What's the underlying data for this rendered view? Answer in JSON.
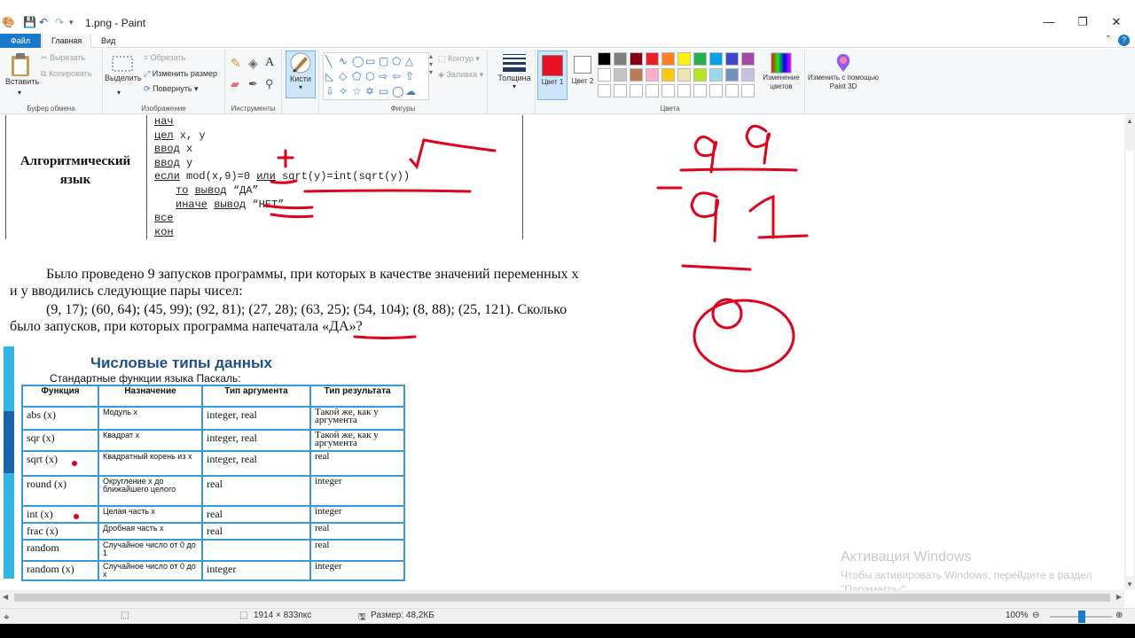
{
  "window": {
    "title": "1.png - Paint",
    "controls": {
      "minimize": "—",
      "maximize": "❐",
      "close": "✕"
    }
  },
  "tabs": {
    "file": "Файл",
    "home": "Главная",
    "view": "Вид"
  },
  "ribbon": {
    "clipboard": {
      "paste": "Вставить",
      "cut": "Вырезать",
      "copy": "Копировать",
      "group": "Буфер обмена"
    },
    "image": {
      "select": "Выделить",
      "crop": "Обрезать",
      "resize": "Изменить размер",
      "rotate": "Повернуть",
      "group": "Изображение"
    },
    "tools": {
      "group": "Инструменты"
    },
    "brushes": {
      "label": "Кисти"
    },
    "shapes": {
      "outline": "Контур",
      "fill": "Заливка",
      "group": "Фигуры"
    },
    "size": {
      "label": "Толщина"
    },
    "colors": {
      "color1": "Цвет 1",
      "color2": "Цвет 2",
      "edit": "Изменение цветов",
      "group": "Цвета",
      "paint3d": "Изменить с помощью Paint 3D",
      "color1_value": "#e81123",
      "color2_value": "#ffffff",
      "palette_row1": [
        "#000000",
        "#7f7f7f",
        "#880015",
        "#ed1c24",
        "#ff7f27",
        "#fff200",
        "#22b14c",
        "#00a2e8",
        "#3f48cc",
        "#a349a4"
      ],
      "palette_row2": [
        "#ffffff",
        "#c3c3c3",
        "#b97a57",
        "#ffaec9",
        "#ffc90e",
        "#efe4b0",
        "#b5e61d",
        "#99d9ea",
        "#7092be",
        "#c8bfe7"
      ]
    }
  },
  "document": {
    "algo_label_line1": "Алгоритмический",
    "algo_label_line2": "язык",
    "code": {
      "l1": "нач",
      "l2a": "цел",
      "l2b": " x, y",
      "l3a": "ввод",
      "l3b": " x",
      "l4a": "ввод",
      "l4b": " y",
      "l5a": "если",
      "l5b": " mod(x,9)=0 ",
      "l5c": "или",
      "l5d": " sqrt(y)=int(sqrt(y))",
      "l6a": "то",
      "l6b": " ",
      "l6c": "вывод",
      "l6d": " “ДА”",
      "l7a": "иначе",
      "l7b": " ",
      "l7c": "вывод",
      "l7d": " “НЕТ”",
      "l8": "все",
      "l9": "кон"
    },
    "para1": "Было проведено 9 запусков программы, при которых в качестве значений переменных x",
    "para2": "и y вводились следующие пары чисел:",
    "para3": "(9, 17); (60, 64); (45, 99); (92, 81); (27, 28); (63, 25); (54, 104); (8, 88); (25, 121). Сколько",
    "para4": "было запусков, при которых программа напечатала «ДА»?",
    "table_title": "Числовые типы данных",
    "table_subtitle": "Стандартные функции языка Паскаль:",
    "table_headers": [
      "Функция",
      "Назначение",
      "Тип аргумента",
      "Тип результата"
    ],
    "table_rows": [
      [
        "abs (x)",
        "Модуль  x",
        "integer, real",
        "Такой же, как у аргумента"
      ],
      [
        "sqr (x)",
        "Квадрат x",
        "integer, real",
        "Такой же, как у аргумента"
      ],
      [
        "sqrt (x)",
        "Квадратный корень из x",
        "integer, real",
        "real"
      ],
      [
        "round (x)",
        "Округление  x до ближайшего целого",
        "real",
        "integer"
      ],
      [
        "int (x)",
        "Целая часть x",
        "real",
        "integer"
      ],
      [
        "frac (x)",
        "Дробная часть x",
        "real",
        "real"
      ],
      [
        "random",
        "Случайное число от 0 до 1",
        "",
        "real"
      ],
      [
        "random (x)",
        "Случайное число от 0 до x",
        "integer",
        "integer"
      ]
    ],
    "handwriting": {
      "plus": "+",
      "n1": "99",
      "minus": "-",
      "n2": "91",
      "n3": "0"
    }
  },
  "watermark": {
    "line1": "Активация Windows",
    "line2": "Чтобы активировать Windows, перейдите в раздел",
    "line3": "\"Параметры\"."
  },
  "status": {
    "dimensions": "1914 × 833пкс",
    "size": "Размер: 48,2КБ",
    "zoom": "100%"
  }
}
